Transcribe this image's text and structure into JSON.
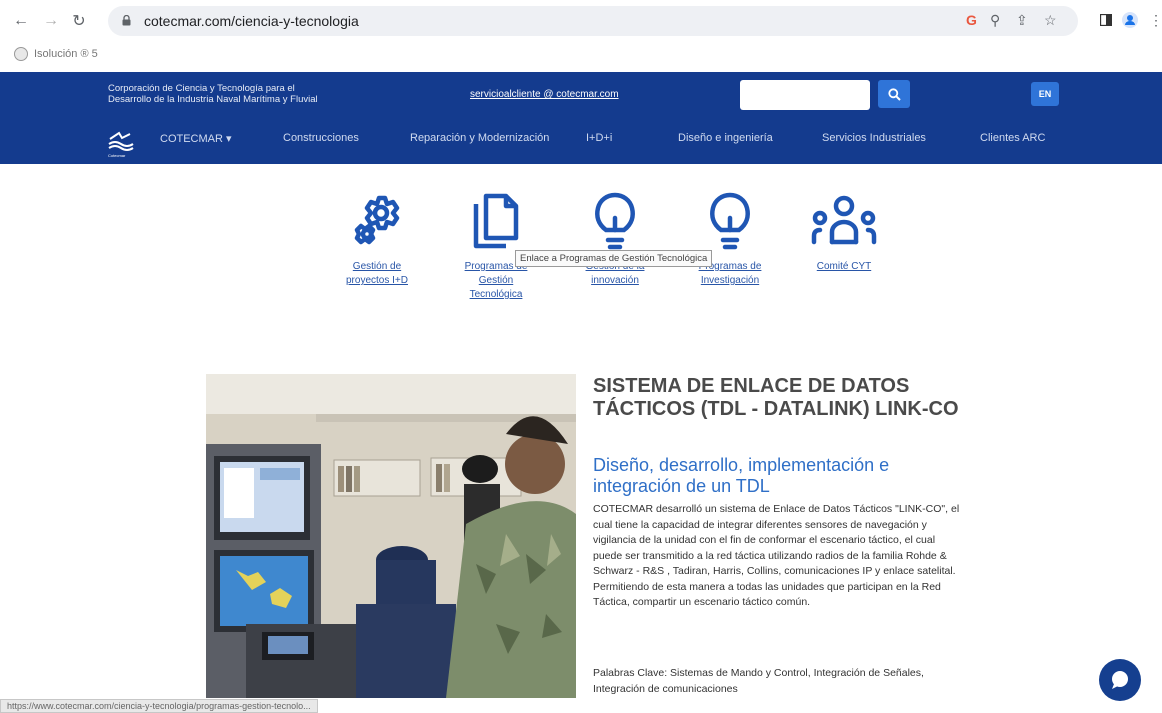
{
  "browser": {
    "url": "cotecmar.com/ciencia-y-tecnologia",
    "bookmark_label": "Isolución ® 5",
    "status_url": "https://www.cotecmar.com/ciencia-y-tecnologia/programas-gestion-tecnolo..."
  },
  "header": {
    "corporation_name": "Corporación de Ciencia y Tecnología para el\nDesarrollo de la Industria Naval Marítima y Fluvial",
    "email": "servicioalcliente @ cotecmar.com",
    "search_placeholder": "",
    "language_button": "EN",
    "logo_caption": "Cotecmar",
    "menu": [
      {
        "label": "COTECMAR ▾"
      },
      {
        "label": "Construcciones"
      },
      {
        "label": "Reparación y Modernización"
      },
      {
        "label": "I+D+i"
      },
      {
        "label": "Diseño e ingeniería"
      },
      {
        "label": "Servicios Industriales"
      },
      {
        "label": "Clientes ARC"
      }
    ]
  },
  "features": [
    {
      "label": "Gestión de\nproyectos I+D",
      "icon": "gear-icon"
    },
    {
      "label": "Programas de\nGestión\nTecnológica",
      "icon": "documents-icon"
    },
    {
      "label": "Gestión de la\ninnovación",
      "icon": "lightbulb-icon"
    },
    {
      "label": "Programas de\nInvestigación",
      "icon": "lightbulb-icon"
    },
    {
      "label": "Comité CYT",
      "icon": "people-icon"
    }
  ],
  "tooltip": "Enlace a Programas de Gestión Tecnológica",
  "article": {
    "title": "SISTEMA DE ENLACE DE DATOS TÁCTICOS (TDL - DATALINK) LINK-CO",
    "subtitle": "Diseño, desarrollo, implementación e integración de un TDL",
    "body": "COTECMAR desarrolló un sistema de Enlace de Datos Tácticos \"LINK-CO\", el cual tiene la capacidad de integrar diferentes sensores de navegación y vigilancia de la unidad con el fin de conformar el escenario táctico, el cual puede ser transmitido a la red táctica utilizando radios de la familia Rohde & Schwarz - R&S , Tadiran, Harris, Collins, comunicaciones IP y enlace satelital. Permitiendo de esta manera a todas las unidades que participan en la Red Táctica, compartir un escenario táctico común.",
    "keywords": "Palabras Clave: Sistemas de Mando y Control, Integración de Señales, Integración de comunicaciones"
  },
  "colors": {
    "header_bg": "#143b8e",
    "accent": "#2f74d8",
    "link": "#2855a7",
    "icon": "#1f56b4",
    "subtitle": "#2f6fc7"
  }
}
